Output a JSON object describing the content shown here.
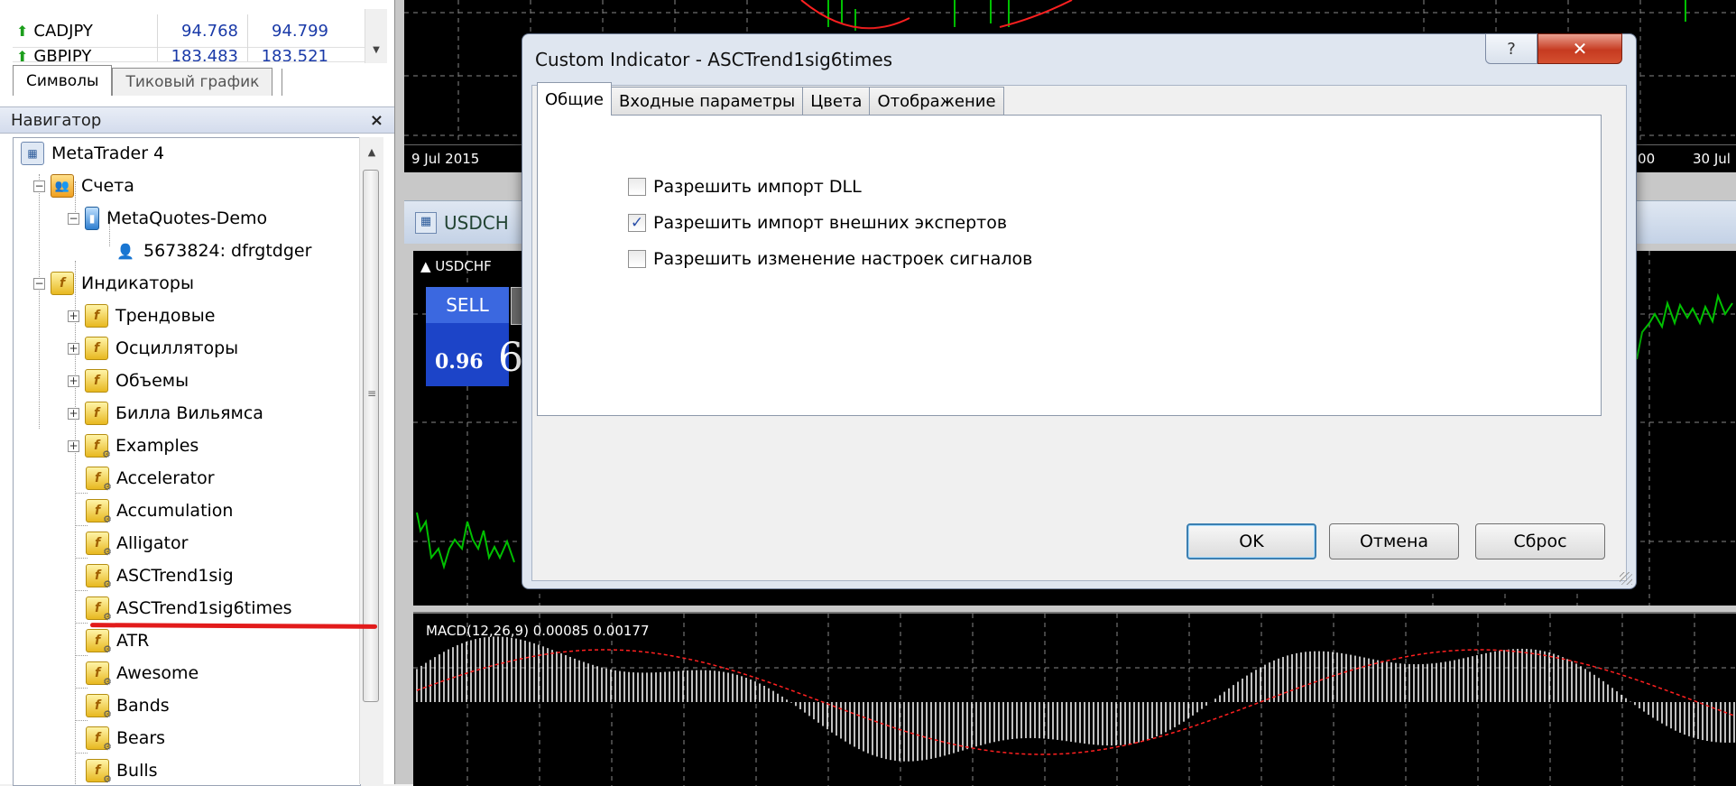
{
  "symbols": [
    {
      "name": "CADJPY",
      "bid": "94.768",
      "ask": "94.799"
    },
    {
      "name": "GBPJPY",
      "bid": "183.483",
      "ask": "183.521"
    }
  ],
  "symbol_tabs": [
    "Символы",
    "Тиковый график"
  ],
  "navigator": {
    "title": "Навигатор",
    "close": "×",
    "root": "MetaTrader 4",
    "accounts": "Счета",
    "server": "MetaQuotes-Demo",
    "account": "5673824: dfrgtdger",
    "indicators": "Индикаторы",
    "groups": [
      "Трендовые",
      "Осцилляторы",
      "Объемы",
      "Билла Вильямса",
      "Examples"
    ],
    "items": [
      "Accelerator",
      "Accumulation",
      "Alligator",
      "ASCTrend1sig",
      "ASCTrend1sig6times",
      "ATR",
      "Awesome",
      "Bands",
      "Bears",
      "Bulls"
    ]
  },
  "chart": {
    "top_dates": [
      "9 Jul 2015",
      ":00",
      "30 Jul"
    ],
    "window_title": "USDCH",
    "symbol_label": "▲ USDCHF",
    "sell_label": "SELL",
    "sell_price": "0.96",
    "sell_big": "6",
    "macd_label": "MACD(12,26,9) 0.00085 0.00177",
    "colors": {
      "up": "#00c000",
      "signal": "#ff2020",
      "hist": "#ffffff"
    }
  },
  "dialog": {
    "title": "Custom Indicator - ASCTrend1sig6times",
    "help": "?",
    "close": "✕",
    "tabs": [
      "Общие",
      "Входные параметры",
      "Цвета",
      "Отображение"
    ],
    "checkboxes": [
      {
        "label": "Разрешить импорт DLL",
        "checked": false
      },
      {
        "label": "Разрешить импорт внешних экспертов",
        "checked": true
      },
      {
        "label": "Разрешить изменение настроек сигналов",
        "checked": false
      }
    ],
    "ok": "OK",
    "cancel": "Отмена",
    "reset": "Сброс"
  }
}
